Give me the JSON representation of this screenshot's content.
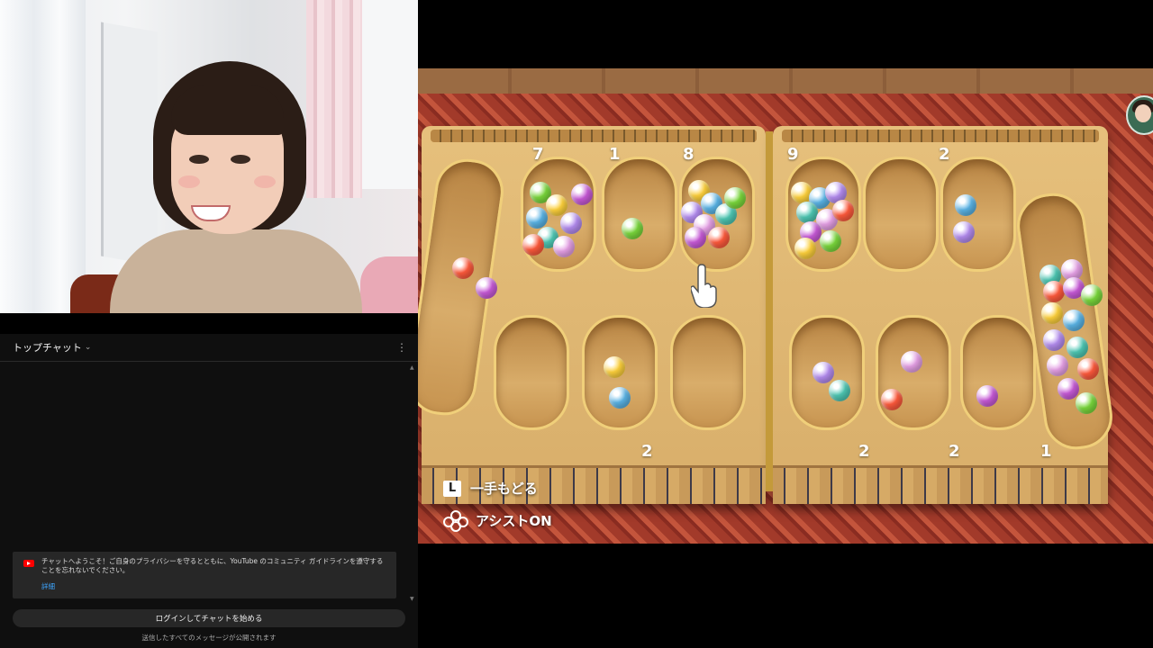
{
  "chat": {
    "title": "トップチャット",
    "welcome_message": "チャットへようこそ！ご自身のプライバシーを守るとともに、YouTube のコミュニティ ガイドラインを遵守することを忘れないでください。",
    "welcome_link": "詳細",
    "login_button": "ログインしてチャットを始める",
    "footer_note": "送信したすべてのメッセージが公開されます"
  },
  "game": {
    "top_counts": [
      "7",
      "1",
      "8",
      "9",
      "2"
    ],
    "bottom_counts": [
      "2",
      "2",
      "2",
      "1"
    ],
    "controls": {
      "undo_key": "L",
      "undo_label": "一手もどる",
      "assist_label": "アシストON"
    },
    "marble_colors": [
      "#ff5a3c",
      "#c85ad8",
      "#7ad83c",
      "#ffd23c",
      "#5ab4e6",
      "#b48cf0",
      "#4ec8b4",
      "#e6a0e6"
    ]
  }
}
